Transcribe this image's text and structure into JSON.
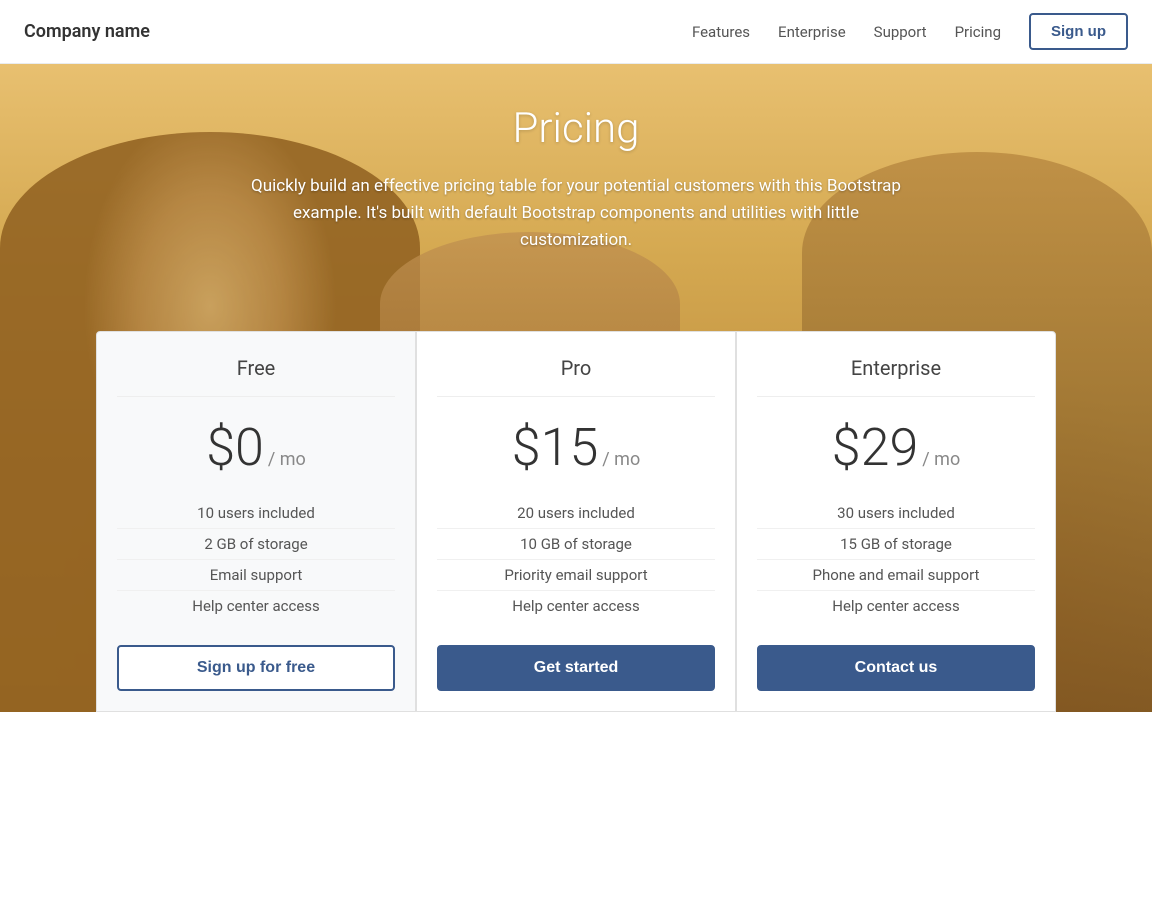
{
  "navbar": {
    "brand": "Company name",
    "nav_items": [
      "Features",
      "Enterprise",
      "Support",
      "Pricing"
    ],
    "signup_label": "Sign up"
  },
  "hero": {
    "title": "Pricing",
    "subtitle": "Quickly build an effective pricing table for your potential customers with this Bootstrap example. It's built with default Bootstrap components and utilities with little customization."
  },
  "plans": [
    {
      "id": "free",
      "name": "Free",
      "price": "$0",
      "period": "/ mo",
      "features": [
        "10 users included",
        "2 GB of storage",
        "Email support",
        "Help center access"
      ],
      "cta": "Sign up for free",
      "cta_style": "outline"
    },
    {
      "id": "pro",
      "name": "Pro",
      "price": "$15",
      "period": "/ mo",
      "features": [
        "20 users included",
        "10 GB of storage",
        "Priority email support",
        "Help center access"
      ],
      "cta": "Get started",
      "cta_style": "primary"
    },
    {
      "id": "enterprise",
      "name": "Enterprise",
      "price": "$29",
      "period": "/ mo",
      "features": [
        "30 users included",
        "15 GB of storage",
        "Phone and email support",
        "Help center access"
      ],
      "cta": "Contact us",
      "cta_style": "primary"
    }
  ]
}
